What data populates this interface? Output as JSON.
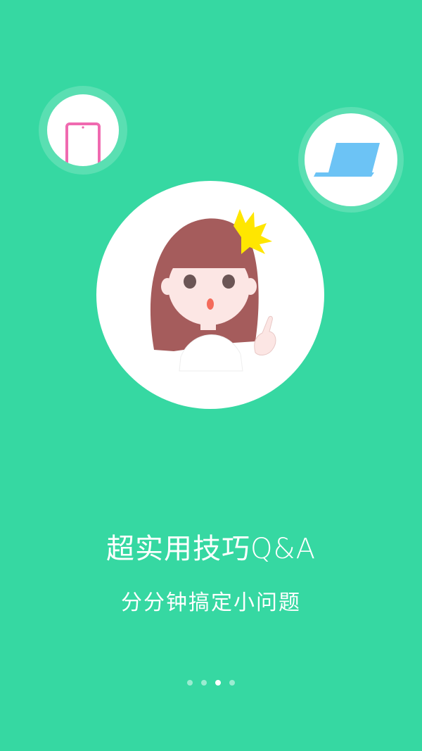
{
  "colors": {
    "background": "#36D8A2",
    "tablet_pink": "#F06AB0",
    "laptop_blue": "#6CC3F5",
    "hair": "#A55C5C",
    "crown": "#FFE600",
    "skin": "#FCE6E4"
  },
  "icons": {
    "tablet": "tablet-icon",
    "laptop": "laptop-icon",
    "avatar": "girl-avatar-illustration"
  },
  "onboarding": {
    "title": "超实用技巧Q&A",
    "subtitle": "分分钟搞定小问题",
    "page_indicator": {
      "total": 4,
      "current": 3
    }
  }
}
